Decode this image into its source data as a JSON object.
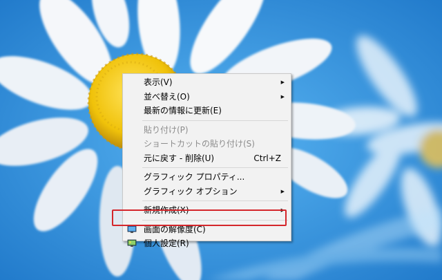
{
  "context_menu": {
    "groups": [
      [
        {
          "label": "表示(V)",
          "has_submenu": true,
          "disabled": false
        },
        {
          "label": "並べ替え(O)",
          "has_submenu": true,
          "disabled": false
        },
        {
          "label": "最新の情報に更新(E)",
          "has_submenu": false,
          "disabled": false
        }
      ],
      [
        {
          "label": "貼り付け(P)",
          "has_submenu": false,
          "disabled": true
        },
        {
          "label": "ショートカットの貼り付け(S)",
          "has_submenu": false,
          "disabled": true
        },
        {
          "label": "元に戻す - 削除(U)",
          "shortcut": "Ctrl+Z",
          "has_submenu": false,
          "disabled": false
        }
      ],
      [
        {
          "label": "グラフィック プロパティ...",
          "has_submenu": false,
          "disabled": false
        },
        {
          "label": "グラフィック オプション",
          "has_submenu": true,
          "disabled": false
        }
      ],
      [
        {
          "label": "新規作成(X)",
          "has_submenu": true,
          "disabled": false
        }
      ],
      [
        {
          "label": "画面の解像度(C)",
          "icon": "display-icon",
          "has_submenu": false,
          "disabled": false,
          "highlighted": true
        },
        {
          "label": "個人設定(R)",
          "icon": "personalize-icon",
          "has_submenu": false,
          "disabled": false
        }
      ]
    ]
  },
  "colors": {
    "highlight_border": "#d4262b",
    "menu_background": "#f2f2f2",
    "disabled_text": "#8c8c8c"
  }
}
